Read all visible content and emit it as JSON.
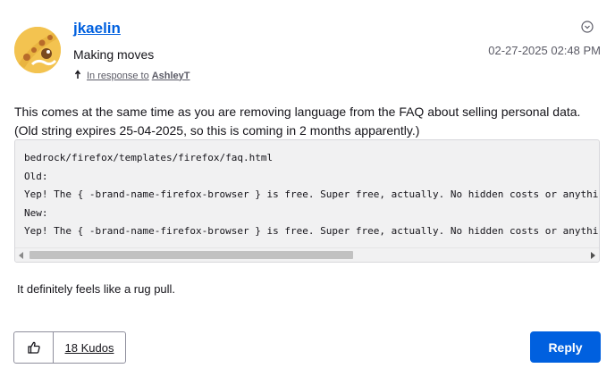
{
  "post": {
    "username": "jkaelin",
    "rank": "Making moves",
    "in_response_prefix": "In response to",
    "in_response_author": "AshleyT",
    "timestamp": "02-27-2025 02:48 PM",
    "body_line": "This comes at the same time as you are removing language from the FAQ about selling personal data. (Old string expires 25-04-2025, so this is coming in 2 months apparently.)",
    "code_lines": [
      "bedrock/firefox/templates/firefox/faq.html",
      "Old:",
      "Yep! The { -brand-name-firefox-browser } is free. Super free, actually. No hidden costs or anything.",
      "New:",
      "Yep! The { -brand-name-firefox-browser } is free. Super free, actually. No hidden costs or anything."
    ],
    "closing_line": "It definitely feels like a rug pull."
  },
  "actions": {
    "kudos_label": "18 Kudos",
    "reply_label": "Reply"
  },
  "icons": {
    "options": "chevron-down-circle-icon",
    "in_response": "arrow-up-turn-icon",
    "kudos": "thumbs-up-icon"
  },
  "colors": {
    "accent": "#0060df",
    "code_bg": "#f1f1f2"
  }
}
